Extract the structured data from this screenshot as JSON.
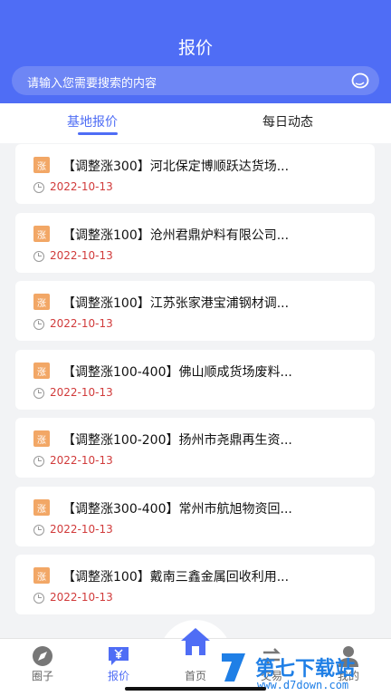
{
  "header": {
    "title": "报价",
    "search_placeholder": "请输入您需要搜索的内容"
  },
  "tabs": [
    {
      "label": "基地报价",
      "active": true
    },
    {
      "label": "每日动态",
      "active": false
    }
  ],
  "list": [
    {
      "badge": "涨",
      "title": "【调整涨300】河北保定博顺跃达货场...",
      "date": "2022-10-13"
    },
    {
      "badge": "涨",
      "title": "【调整涨100】沧州君鼎炉料有限公司...",
      "date": "2022-10-13"
    },
    {
      "badge": "涨",
      "title": "【调整涨100】江苏张家港宝浦钢材调...",
      "date": "2022-10-13"
    },
    {
      "badge": "涨",
      "title": "【调整涨100-400】佛山顺成货场废料...",
      "date": "2022-10-13"
    },
    {
      "badge": "涨",
      "title": "【调整涨100-200】扬州市尧鼎再生资...",
      "date": "2022-10-13"
    },
    {
      "badge": "涨",
      "title": "【调整涨300-400】常州市航旭物资回...",
      "date": "2022-10-13"
    },
    {
      "badge": "涨",
      "title": "【调整涨100】戴南三鑫金属回收利用...",
      "date": "2022-10-13"
    }
  ],
  "tabbar": [
    {
      "label": "圈子",
      "icon": "circle-compass-icon"
    },
    {
      "label": "报价",
      "icon": "yen-chat-icon",
      "active": true
    },
    {
      "label": "首页",
      "icon": "home-icon"
    },
    {
      "label": "交易",
      "icon": "exchange-icon"
    },
    {
      "label": "我的",
      "icon": "user-icon"
    }
  ],
  "watermark": {
    "text": "第七下载站",
    "url": "www.d7down.com"
  },
  "colors": {
    "primary": "#4f6df5",
    "date_red": "#d13b3b",
    "badge_orange": "#f2a766",
    "watermark_blue": "#1f7fe6"
  }
}
